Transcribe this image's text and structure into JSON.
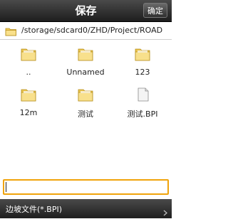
{
  "header": {
    "title": "保存",
    "confirm_label": "确定"
  },
  "path": {
    "text": "/storage/sdcard0/ZHD/Project/ROAD",
    "icon": "folder-icon"
  },
  "files": [
    {
      "name": "..",
      "type": "folder"
    },
    {
      "name": "Unnamed",
      "type": "folder"
    },
    {
      "name": "123",
      "type": "folder"
    },
    {
      "name": "12m",
      "type": "folder"
    },
    {
      "name": "测试",
      "type": "folder"
    },
    {
      "name": "测试.BPI",
      "type": "file"
    }
  ],
  "filename_input": {
    "value": "",
    "placeholder": ""
  },
  "filetype": {
    "label": "边坡文件(*.BPI)",
    "icon": "chevron-right-icon"
  },
  "colors": {
    "accent": "#f0a30a",
    "folder": "#f5d66b",
    "bar": "#2e2e2e"
  }
}
